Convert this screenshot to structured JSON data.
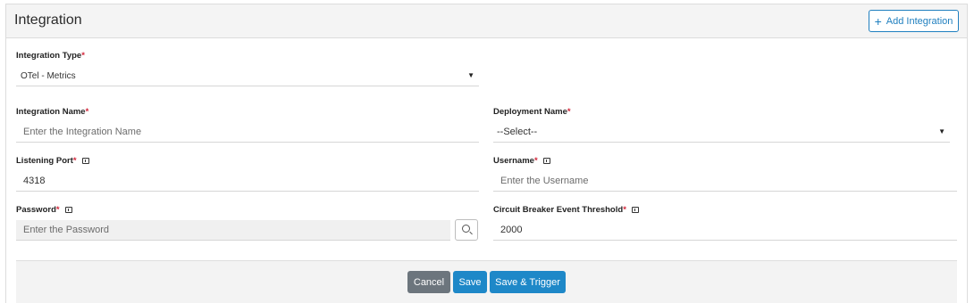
{
  "header": {
    "title": "Integration",
    "add_button_label": "Add Integration",
    "add_icon": "plus-icon"
  },
  "form": {
    "integration_type": {
      "label": "Integration Type",
      "required": "*",
      "value": "OTel - Metrics"
    },
    "integration_name": {
      "label": "Integration Name",
      "required": "*",
      "placeholder": "Enter the Integration Name"
    },
    "deployment_name": {
      "label": "Deployment Name",
      "required": "*",
      "value": "--Select--"
    },
    "listening_port": {
      "label": "Listening Port",
      "required": "*",
      "value": "4318",
      "icon": "info-icon"
    },
    "username": {
      "label": "Username",
      "required": "*",
      "placeholder": "Enter the Username",
      "icon": "info-icon"
    },
    "password": {
      "label": "Password",
      "required": "*",
      "placeholder": "Enter the Password",
      "icon": "info-icon",
      "button_icon": "search-icon"
    },
    "circuit_breaker": {
      "label": "Circuit Breaker Event Threshold",
      "required": "*",
      "value": "2000",
      "icon": "info-icon"
    }
  },
  "footer": {
    "cancel_label": "Cancel",
    "save_label": "Save",
    "save_trigger_label": "Save & Trigger"
  },
  "colors": {
    "primary": "#1e88c8",
    "secondary": "#6c757d",
    "required": "#d2263a"
  }
}
